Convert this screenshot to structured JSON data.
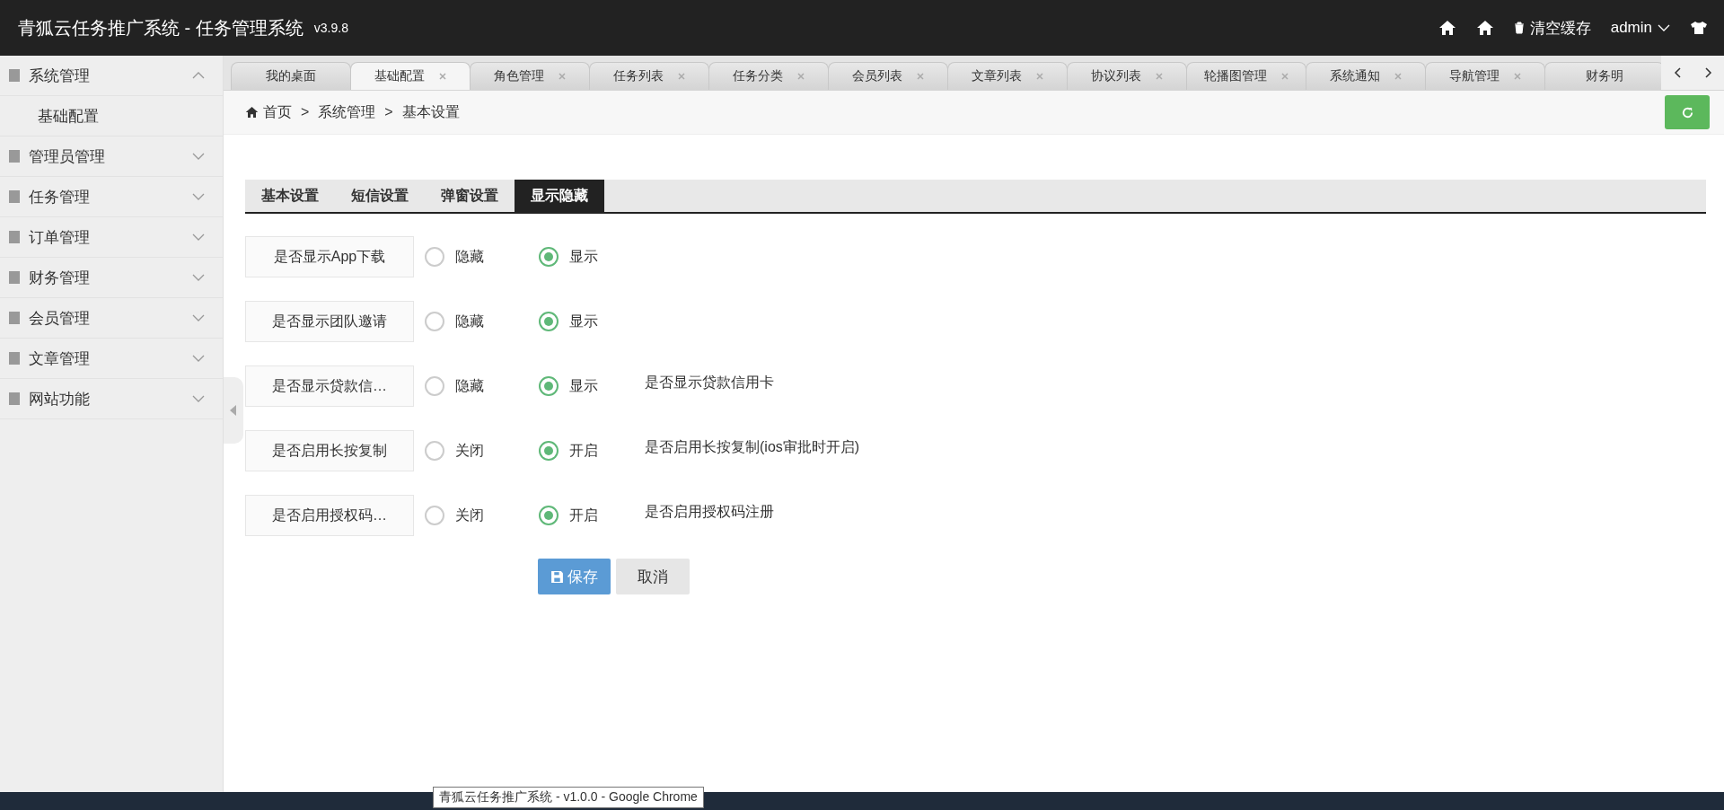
{
  "header": {
    "title": "青狐云任务推广系统 - 任务管理系统",
    "version": "v3.9.8",
    "clear_cache": "清空缓存",
    "user": "admin"
  },
  "sidebar": {
    "items": [
      {
        "label": "系统管理",
        "expanded": true,
        "children": [
          {
            "label": "基础配置"
          }
        ]
      },
      {
        "label": "管理员管理",
        "expanded": false
      },
      {
        "label": "任务管理",
        "expanded": false
      },
      {
        "label": "订单管理",
        "expanded": false
      },
      {
        "label": "财务管理",
        "expanded": false
      },
      {
        "label": "会员管理",
        "expanded": false
      },
      {
        "label": "文章管理",
        "expanded": false
      },
      {
        "label": "网站功能",
        "expanded": false
      }
    ]
  },
  "page_tabs": [
    {
      "label": "我的桌面",
      "selected": false,
      "closable": false
    },
    {
      "label": "基础配置",
      "selected": true,
      "closable": true
    },
    {
      "label": "角色管理",
      "selected": false,
      "closable": true
    },
    {
      "label": "任务列表",
      "selected": false,
      "closable": true
    },
    {
      "label": "任务分类",
      "selected": false,
      "closable": true
    },
    {
      "label": "会员列表",
      "selected": false,
      "closable": true
    },
    {
      "label": "文章列表",
      "selected": false,
      "closable": true
    },
    {
      "label": "协议列表",
      "selected": false,
      "closable": true
    },
    {
      "label": "轮播图管理",
      "selected": false,
      "closable": true
    },
    {
      "label": "系统通知",
      "selected": false,
      "closable": true
    },
    {
      "label": "导航管理",
      "selected": false,
      "closable": true
    },
    {
      "label": "财务明",
      "selected": false,
      "closable": false
    }
  ],
  "breadcrumb": [
    {
      "kind": "home",
      "text": "首页"
    },
    {
      "kind": "separator",
      "text": ">"
    },
    {
      "kind": "link",
      "text": "系统管理"
    },
    {
      "kind": "separator",
      "text": ">"
    },
    {
      "kind": "link",
      "text": "基本设置"
    }
  ],
  "settings_tabs": [
    {
      "label": "基本设置",
      "selected": false
    },
    {
      "label": "短信设置",
      "selected": false
    },
    {
      "label": "弹窗设置",
      "selected": false
    },
    {
      "label": "显示隐藏",
      "selected": true
    }
  ],
  "form_rows": [
    {
      "label": "是否显示App下载",
      "options": [
        {
          "label": "隐藏",
          "selected": false
        },
        {
          "label": "显示",
          "selected": true
        }
      ]
    },
    {
      "label": "是否显示团队邀请",
      "options": [
        {
          "label": "隐藏",
          "selected": false
        },
        {
          "label": "显示",
          "selected": true
        }
      ]
    },
    {
      "label": "是否显示贷款信…",
      "options": [
        {
          "label": "隐藏",
          "selected": false
        },
        {
          "label": "显示",
          "selected": true
        }
      ],
      "description": "是否显示贷款信用卡"
    },
    {
      "label": "是否启用长按复制",
      "options": [
        {
          "label": "关闭",
          "selected": false
        },
        {
          "label": "开启",
          "selected": true
        }
      ],
      "description": "是否启用长按复制(ios审批时开启)"
    },
    {
      "label": "是否启用授权码…",
      "options": [
        {
          "label": "关闭",
          "selected": false
        },
        {
          "label": "开启",
          "selected": true
        }
      ],
      "description": "是否启用授权码注册"
    }
  ],
  "buttons": {
    "save": "保存",
    "cancel": "取消"
  },
  "tooltip": "青狐云任务推广系统 - v1.0.0 - Google Chrome"
}
